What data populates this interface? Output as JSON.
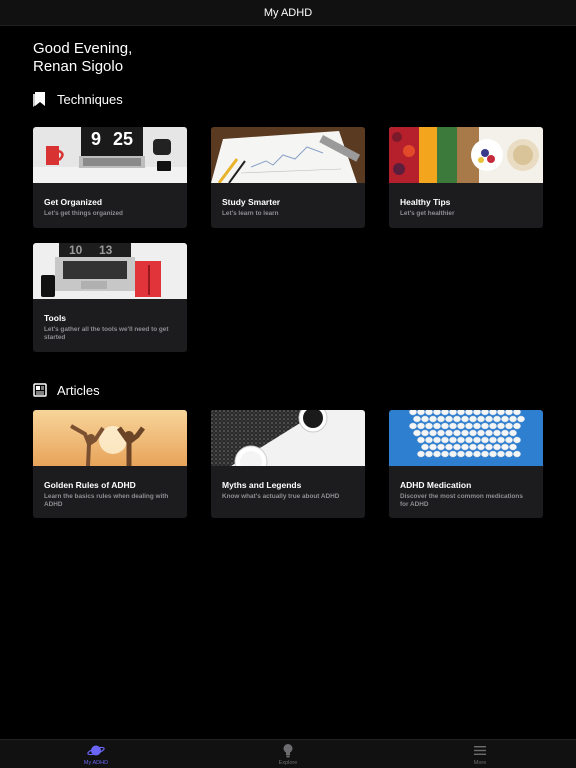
{
  "navbar": {
    "title": "My ADHD"
  },
  "greeting": {
    "line1": "Good Evening,",
    "line2": "Renan Sigolo"
  },
  "techniques": {
    "header": "Techniques",
    "icon": "bookmark-icon",
    "cards": [
      {
        "title": "Get Organized",
        "subtitle": "Let's get things organized",
        "image": "desk-laptop-clock"
      },
      {
        "title": "Study Smarter",
        "subtitle": "Let's learn to learn",
        "image": "chart-paper-pens"
      },
      {
        "title": "Healthy Tips",
        "subtitle": "Let's get healthier",
        "image": "food-bowls"
      },
      {
        "title": "Tools",
        "subtitle": "Let's gather all the tools we'll need to get started",
        "image": "laptop-notebook"
      }
    ]
  },
  "articles": {
    "header": "Articles",
    "icon": "newspaper-icon",
    "cards": [
      {
        "title": "Golden Rules of ADHD",
        "subtitle": "Learn the basics rules when dealing with ADHD",
        "image": "people-sunset"
      },
      {
        "title": "Myths and Legends",
        "subtitle": "Know what's actually true about ADHD",
        "image": "cups-black-white"
      },
      {
        "title": "ADHD Medication",
        "subtitle": "Discover the most common medications for ADHD",
        "image": "pills-blue"
      }
    ]
  },
  "tabbar": {
    "tabs": [
      {
        "label": "My ADHD",
        "icon": "planet-icon",
        "active": true
      },
      {
        "label": "Explore",
        "icon": "lightbulb-icon",
        "active": false
      },
      {
        "label": "More",
        "icon": "menu-icon",
        "active": false
      }
    ]
  },
  "colors": {
    "accent": "#6a65f5",
    "card_bg": "#1c1c1e",
    "subtitle": "#8e8e93"
  }
}
